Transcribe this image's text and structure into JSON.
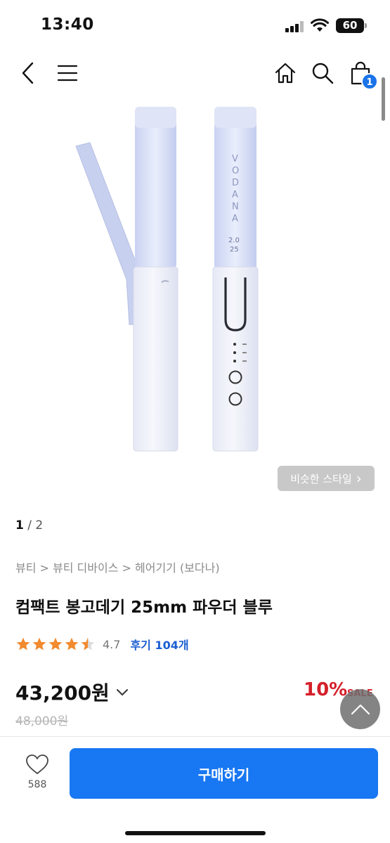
{
  "status": {
    "time": "13:40",
    "battery": "60"
  },
  "nav": {
    "cart_count": "1"
  },
  "similar": {
    "label": "비슷한 스타일",
    "chevron": "›"
  },
  "pager": {
    "current": "1",
    "separator": " / ",
    "total": "2"
  },
  "breadcrumb": "뷰티 > 뷰티 디바이스 > 헤어기기 (보다나)",
  "product": {
    "title": "컴팩트 봉고데기 25mm 파우더 블루",
    "rating": "4.7",
    "rating_stars": 4.5,
    "review_label": "후기 104개",
    "price": "43,200원",
    "original_price": "48,000원",
    "discount": "10%",
    "sale_label": "SALE"
  },
  "device_label": {
    "brand": "VODANA",
    "size_a": "2.0",
    "size_b": "25"
  },
  "bottom": {
    "like_count": "588",
    "buy_label": "구매하기"
  },
  "colors": {
    "accent": "#1877f2",
    "sale": "#d4202a",
    "star": "#f28a2e",
    "review_link": "#1a5fd0"
  }
}
